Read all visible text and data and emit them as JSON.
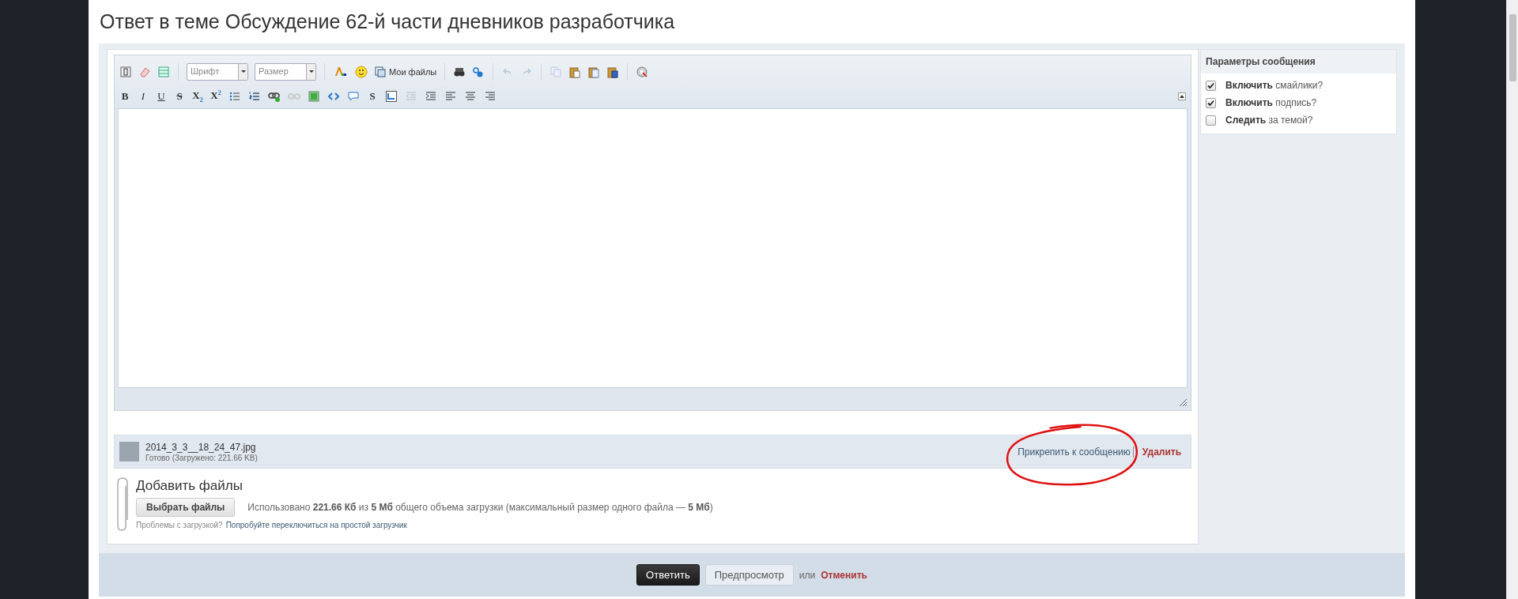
{
  "title": "Ответ в теме Обсуждение 62-й части дневников разработчика",
  "editor": {
    "font_select": "Шрифт",
    "size_select": "Размер",
    "my_files_button": "Мои файлы",
    "format_buttons": [
      {
        "kind": "bold",
        "label": "B"
      },
      {
        "kind": "italic",
        "label": "I"
      },
      {
        "kind": "underline",
        "label": "U"
      },
      {
        "kind": "strike",
        "label": "S"
      },
      {
        "kind": "sub",
        "label": "X$_{2}$"
      },
      {
        "kind": "sup",
        "label": "X$^{2}$"
      },
      {
        "kind": "plain",
        "label": "S"
      }
    ]
  },
  "attachment": {
    "file_name": "2014_3_3__18_24_47.jpg",
    "status": "Готово (Загружено: 221.66 KB)",
    "attach_link": "Прикрепить к сообщению",
    "delete_link": "Удалить"
  },
  "upload": {
    "heading": "Добавить файлы",
    "choose_button": "Выбрать файлы",
    "usage": "Использовано **221.66 Кб** из **5 Мб** общего объема загрузки (максимальный размер одного файла — **5 Мб**)",
    "help_text": "Проблемы с загрузкой?",
    "help_link": "Попробуйте переключиться на простой загрузчик"
  },
  "options": {
    "title": "Параметры сообщения",
    "items": [
      {
        "label": "**Включить** смайлики?",
        "checked": true
      },
      {
        "label": "**Включить** подпись?",
        "checked": true
      },
      {
        "label": "**Следить** за темой?",
        "checked": false
      }
    ]
  },
  "actions": {
    "submit": "Ответить",
    "preview": "Предпросмотр",
    "or": "или",
    "cancel": "Отменить"
  }
}
